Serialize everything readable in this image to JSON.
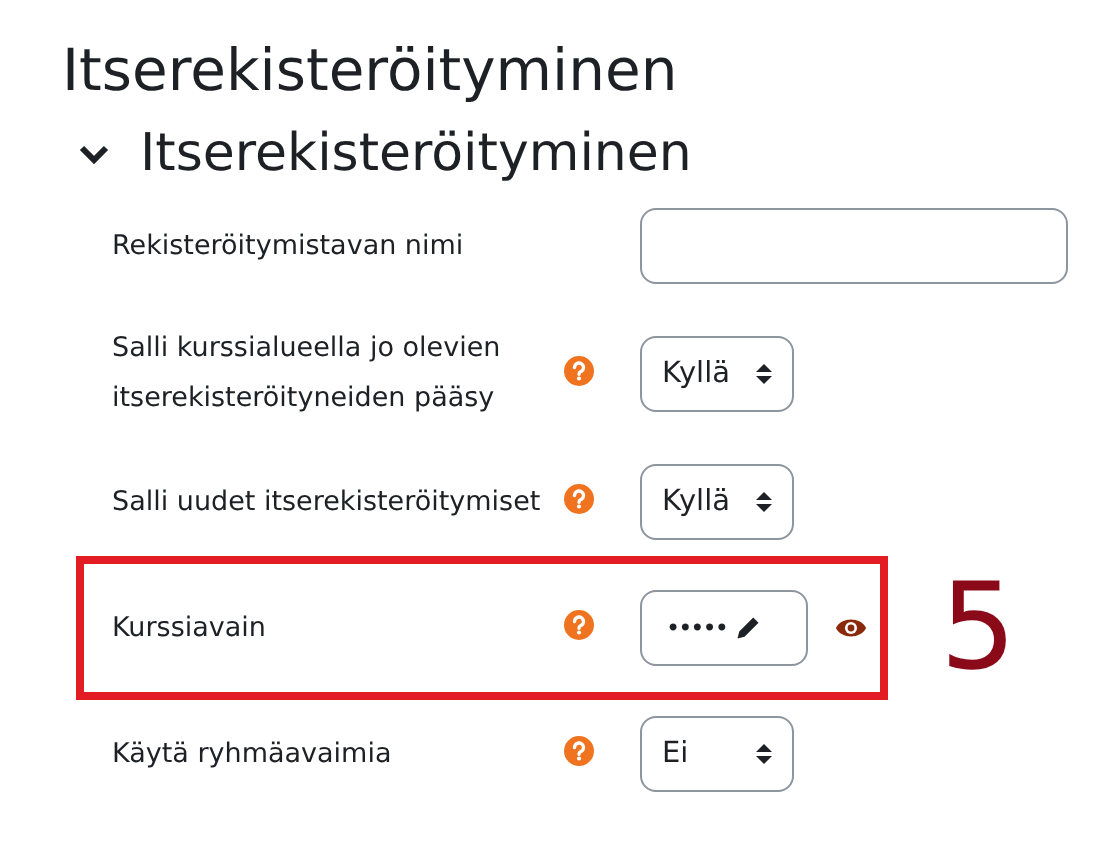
{
  "page_title": "Itserekisteröityminen",
  "section": {
    "title": "Itserekisteröityminen",
    "expanded": true
  },
  "fields": [
    {
      "kind": "text",
      "label": "Rekisteröitymistavan nimi",
      "help": false,
      "highlighted": false
    },
    {
      "kind": "select",
      "label": "Salli kurssialueella jo olevien itserekisteröityneiden pääsy",
      "help": true,
      "value": "Kyllä",
      "highlighted": false
    },
    {
      "kind": "select",
      "label": "Salli uudet itserekisteröitymiset",
      "help": true,
      "value": "Kyllä",
      "highlighted": false
    },
    {
      "kind": "password",
      "label": "Kurssiavain",
      "help": true,
      "value": "•••••",
      "highlighted": true,
      "callout": "5"
    },
    {
      "kind": "select",
      "label": "Käytä ryhmäavaimia",
      "help": true,
      "value": "Ei",
      "highlighted": false
    }
  ]
}
